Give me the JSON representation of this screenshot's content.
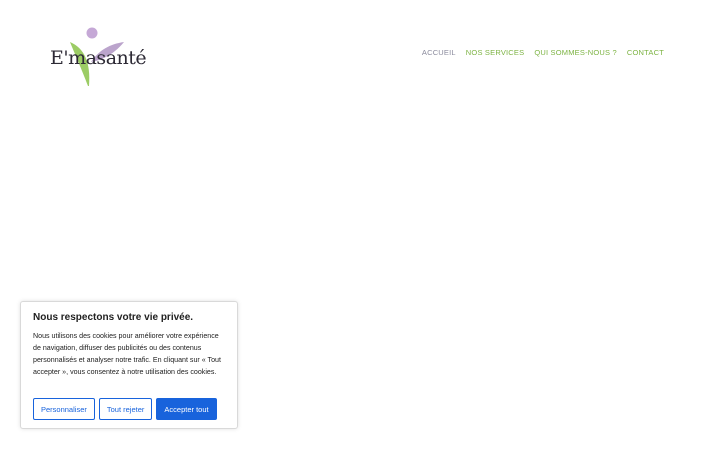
{
  "logo": {
    "text": "E'masanté",
    "icon": "leaf-person-logo-icon",
    "colors": {
      "circle": "#c5a8d6",
      "leaf_left": "#8bc34a",
      "leaf_right": "#b49ac6"
    }
  },
  "nav": {
    "items": [
      {
        "label": "ACCUEIL",
        "state": "active"
      },
      {
        "label": "NOS SERVICES"
      },
      {
        "label": "QUI SOMMES-NOUS ?"
      },
      {
        "label": "CONTACT"
      }
    ],
    "colors": {
      "active": "#8a8a9c",
      "default": "#7cb342"
    }
  },
  "cookie_banner": {
    "title": "Nous respectons votre vie privée.",
    "body": "Nous utilisons des cookies pour améliorer votre expérience de navigation, diffuser des publicités ou des contenus personnalisés et analyser notre trafic. En cliquant sur « Tout accepter », vous consentez à notre utilisation des cookies.",
    "buttons": {
      "customize": "Personnaliser",
      "reject": "Tout rejeter",
      "accept": "Accepter tout"
    },
    "accent_color": "#1863dc"
  }
}
